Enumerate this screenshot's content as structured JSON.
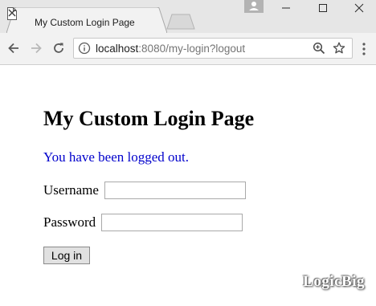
{
  "browser": {
    "tab": {
      "title": "My Custom Login Page",
      "icon": "document-icon",
      "close_icon": "close-icon"
    },
    "new_tab_icon": "new-tab-icon",
    "window_controls": [
      "minimize-icon",
      "maximize-icon",
      "close-icon"
    ],
    "profile_icon": "person-icon",
    "toolbar": {
      "back_icon": "arrow-left-icon",
      "forward_icon": "arrow-right-icon",
      "reload_icon": "reload-icon",
      "menu_icon": "more-vertical-icon"
    },
    "address_bar": {
      "host": "localhost",
      "rest": ":8080/my-login?logout",
      "info_icon": "info-icon",
      "zoom_icon": "zoom-in-icon",
      "bookmark_icon": "star-icon"
    }
  },
  "page": {
    "title": "My Custom Login Page",
    "message": "You have been logged out.",
    "username_label": "Username",
    "username_value": "",
    "password_label": "Password",
    "password_value": "",
    "login_button": "Log in"
  },
  "watermark": "LogicBig",
  "colors": {
    "message": "#0000cc",
    "titlebar": "#e6e6e6",
    "toolbar": "#f2f2f2"
  }
}
